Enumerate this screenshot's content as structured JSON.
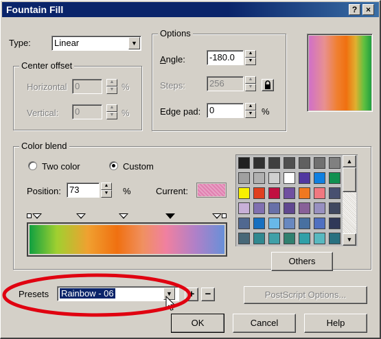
{
  "window": {
    "title": "Fountain Fill",
    "help_btn": "?",
    "close_btn": "×"
  },
  "type": {
    "label": "Type:",
    "value": "Linear"
  },
  "center_offset": {
    "title": "Center offset",
    "horizontal_label": "Horizontal",
    "horizontal_value": "0",
    "vertical_label": "Vertical:",
    "vertical_value": "0",
    "unit": "%"
  },
  "options": {
    "title": "Options",
    "angle_label": "Angle:",
    "angle_value": "-180.0",
    "steps_label": "Steps:",
    "steps_value": "256",
    "edge_pad_label": "Edge pad:",
    "edge_pad_value": "0",
    "unit": "%"
  },
  "color_blend": {
    "title": "Color blend",
    "two_color_label": "Two color",
    "custom_label": "Custom",
    "selected_mode": "custom",
    "position_label": "Position:",
    "position_value": "73",
    "unit": "%",
    "current_label": "Current:",
    "current_color": "#e080b0",
    "others_button": "Others"
  },
  "palette_colors": [
    "#202020",
    "#303030",
    "#404040",
    "#505050",
    "#606060",
    "#707070",
    "#808080",
    "#a0a0a0",
    "#b0b0b0",
    "#d0d0d0",
    "#ffffff",
    "#5038a0",
    "#1080e0",
    "#109050",
    "#f8f000",
    "#e04020",
    "#c01040",
    "#7050a0",
    "#f07820",
    "#f07880",
    "#485070",
    "#c8b0d8",
    "#8070b0",
    "#6870a8",
    "#604890",
    "#886098",
    "#9890c0",
    "#404860",
    "#506890",
    "#1870c0",
    "#68b8e8",
    "#6888c0",
    "#4870a0",
    "#5070c0",
    "#303858",
    "#486878",
    "#308890",
    "#40a0a8",
    "#308070",
    "#30a0a8",
    "#58b8c0",
    "#287080"
  ],
  "presets": {
    "label": "Presets",
    "value": "Rainbow - 06"
  },
  "buttons": {
    "add": "+",
    "remove": "−",
    "postscript": "PostScript Options...",
    "ok": "OK",
    "cancel": "Cancel",
    "help": "Help"
  },
  "colors": {
    "title_bar": "#0a246a",
    "dialog_bg": "#d4d0c8",
    "selection": "#0a246a",
    "annotation": "#e00010"
  }
}
